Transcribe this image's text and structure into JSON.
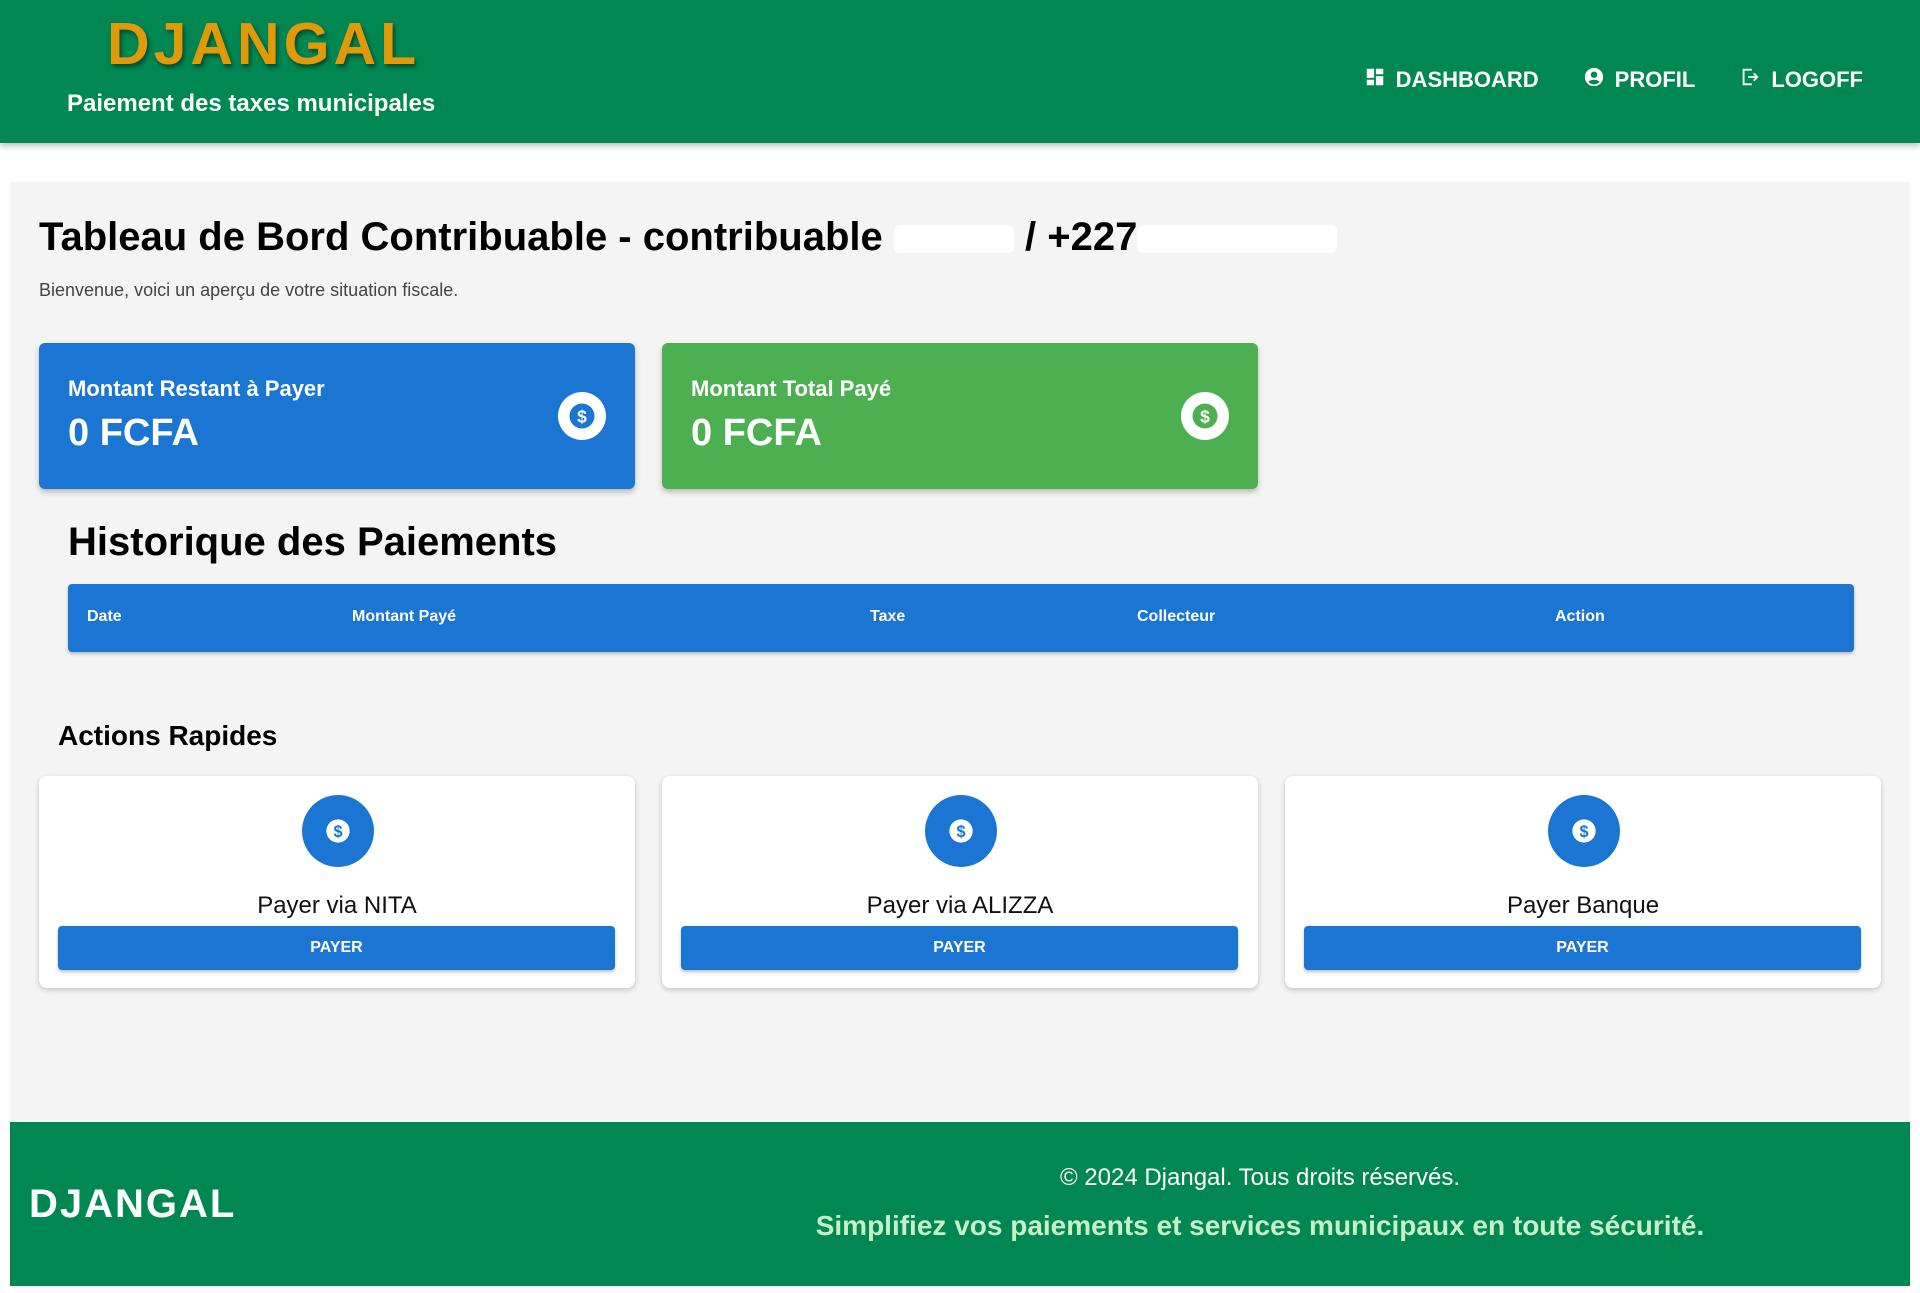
{
  "header": {
    "brand": "DJANGAL",
    "tagline": "Paiement des taxes municipales",
    "nav": [
      {
        "label": "DASHBOARD",
        "icon": "dashboard-icon"
      },
      {
        "label": "PROFIL",
        "icon": "account-circle-icon"
      },
      {
        "label": "LOGOFF",
        "icon": "logout-icon"
      }
    ]
  },
  "main": {
    "title_prefix": "Tableau de Bord Contribuable - contribuable",
    "title_middle": "/ +227",
    "subtitle": "Bienvenue, voici un aperçu de votre situation fiscale.",
    "stats": [
      {
        "label": "Montant Restant à Payer",
        "value": "0 FCFA",
        "color": "#1b75d2",
        "icon": "dollar-circle-icon"
      },
      {
        "label": "Montant Total Payé",
        "value": "0 FCFA",
        "color": "#4caf50",
        "icon": "dollar-circle-icon"
      }
    ],
    "history": {
      "title": "Historique des Paiements",
      "columns": [
        "Date",
        "Montant Payé",
        "Taxe",
        "Collecteur",
        "Action"
      ],
      "rows": []
    },
    "quick_actions": {
      "title": "Actions Rapides",
      "items": [
        {
          "label": "Payer via NITA",
          "button": "PAYER",
          "icon": "dollar-circle-icon"
        },
        {
          "label": "Payer via ALIZZA",
          "button": "PAYER",
          "icon": "dollar-circle-icon"
        },
        {
          "label": "Payer Banque",
          "button": "PAYER",
          "icon": "dollar-circle-icon"
        }
      ]
    }
  },
  "footer": {
    "brand": "DJANGAL",
    "copyright": "© 2024 Djangal. Tous droits réservés.",
    "slogan": "Simplifiez vos paiements et services municipaux en toute sécurité."
  },
  "colors": {
    "primary_green": "#018752",
    "brand_orange": "#e09a07",
    "primary_blue": "#1b75d2",
    "success_green": "#4caf50"
  }
}
